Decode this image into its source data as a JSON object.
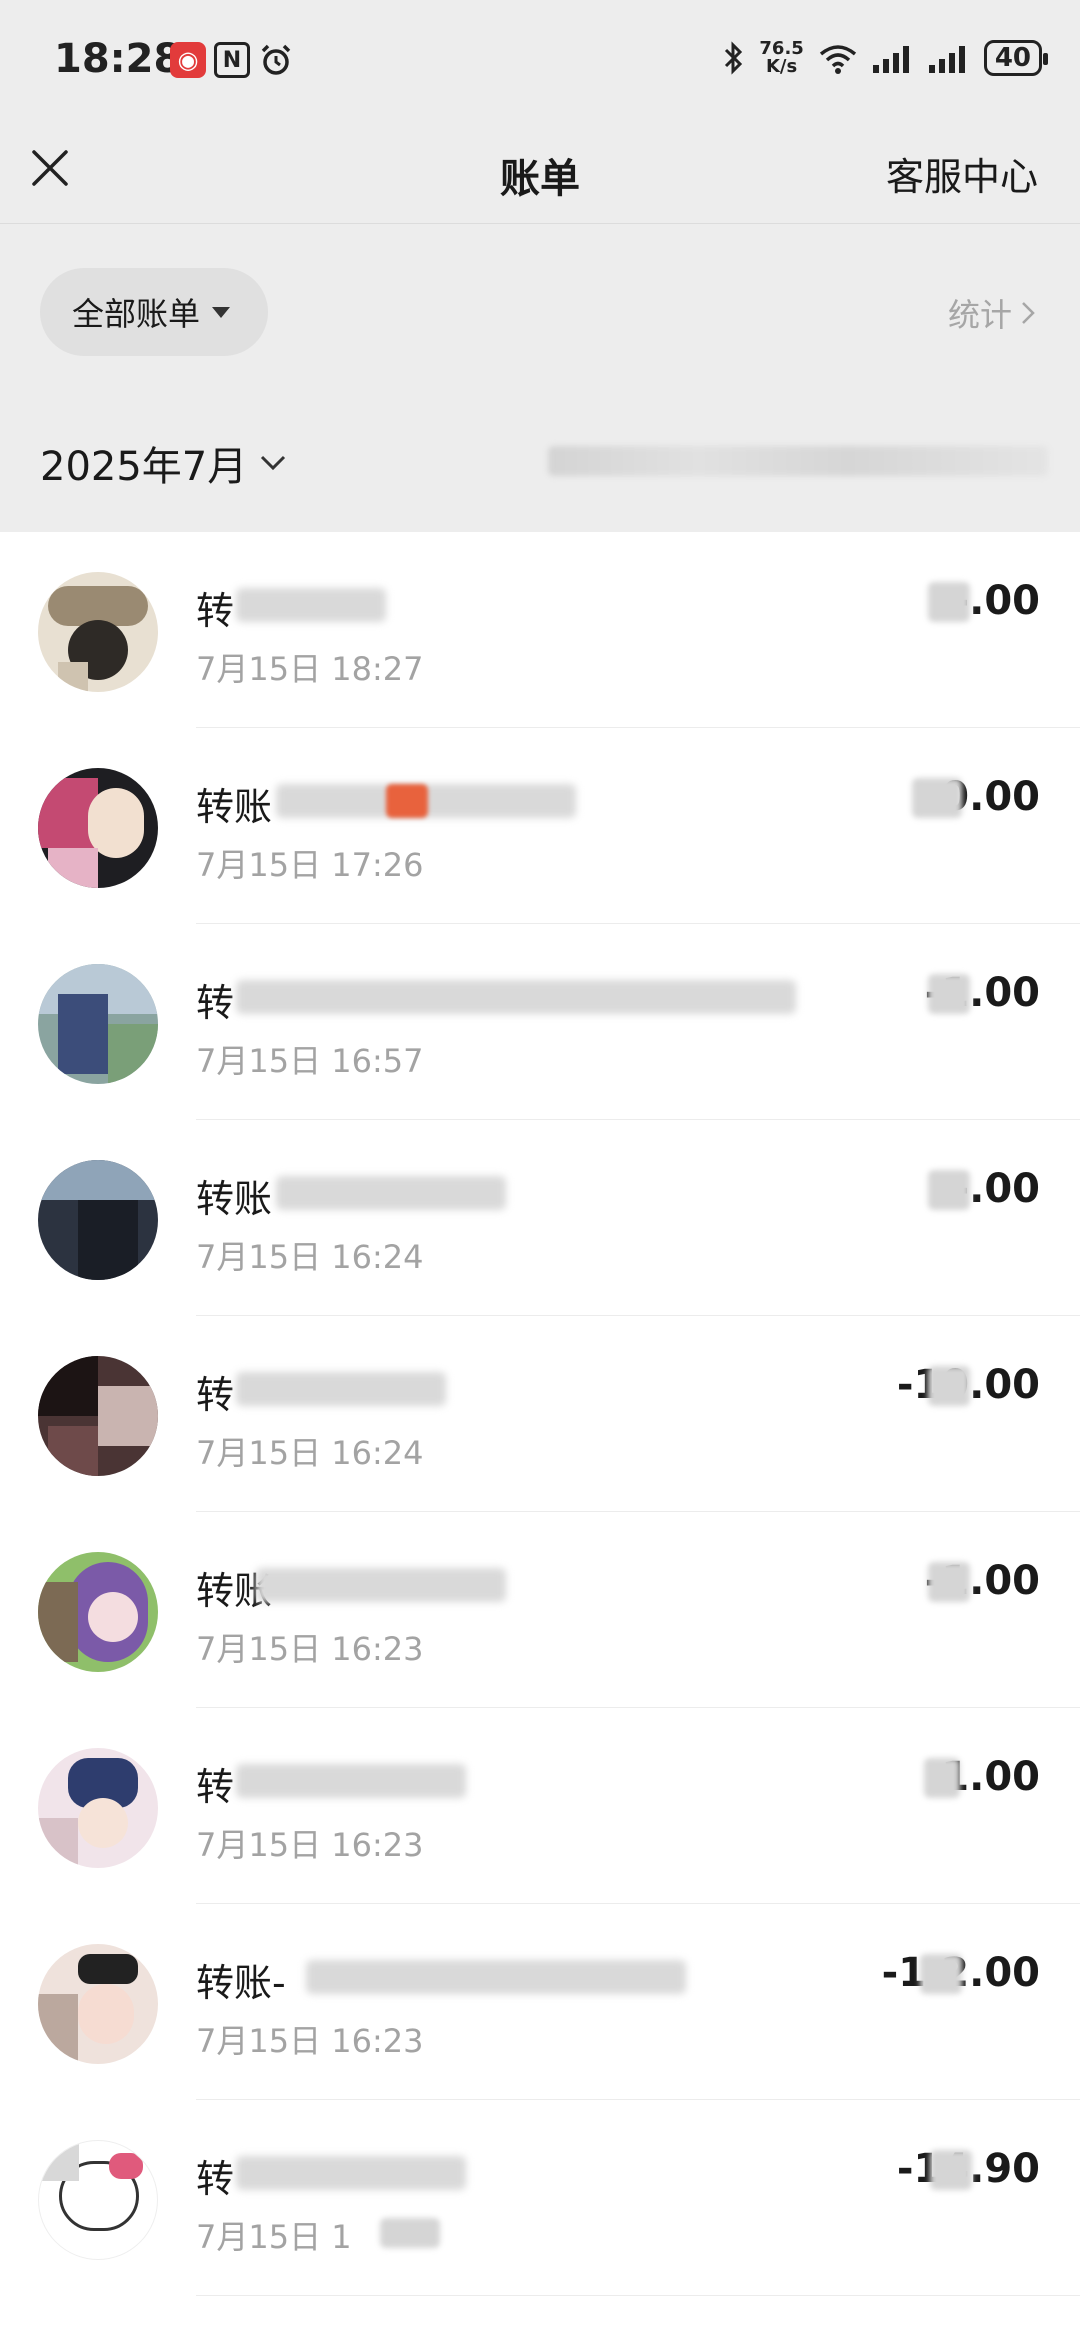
{
  "status_bar": {
    "time": "18:28",
    "net_speed_value": "76.5",
    "net_speed_unit": "K/s",
    "battery": "40"
  },
  "nav": {
    "title": "账单",
    "service": "客服中心"
  },
  "filter": {
    "label": "全部账单",
    "stats_label": "统计"
  },
  "month": {
    "label": "2025年7月"
  },
  "transactions": [
    {
      "title": "转",
      "time": "7月15日 18:27",
      "amount": "-.00",
      "avatar_color": "#6b5a48"
    },
    {
      "title": "转账",
      "time": "7月15日 17:26",
      "amount": "0.00",
      "avatar_color": "#c44a72"
    },
    {
      "title": "转",
      "time": "7月15日 16:57",
      "amount": "-1.00",
      "avatar_color": "#5d7a9a"
    },
    {
      "title": "转账",
      "time": "7月15日 16:24",
      "amount": "-.00",
      "avatar_color": "#3f4a55"
    },
    {
      "title": "转",
      "time": "7月15日 16:24",
      "amount": "-10.00",
      "avatar_color": "#3a2a2a"
    },
    {
      "title": "转账",
      "time": "7月15日 16:23",
      "amount": "-1.00",
      "avatar_color": "#7b5aa8"
    },
    {
      "title": "转",
      "time": "7月15日 16:23",
      "amount": "1.00",
      "avatar_color": "#e6d0d8"
    },
    {
      "title": "转账-",
      "time": "7月15日 16:23",
      "amount": "-1.2.00",
      "avatar_color": "#d9b8b0"
    },
    {
      "title": "转",
      "time": "7月15日 1",
      "amount": "-14.90",
      "avatar_color": "#f0e6ea"
    }
  ]
}
